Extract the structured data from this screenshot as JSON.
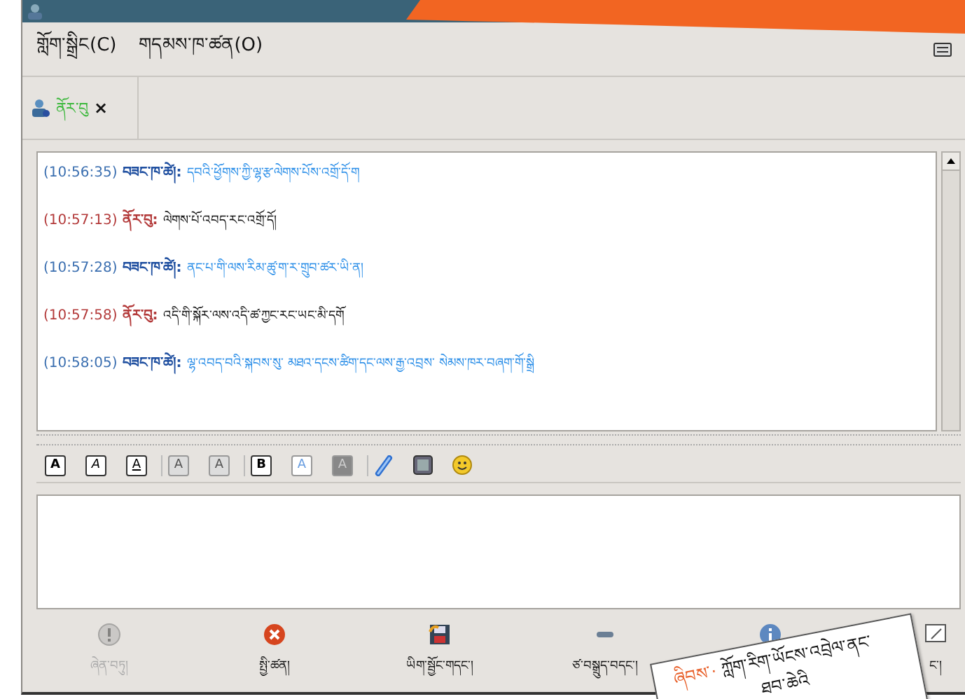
{
  "menu": [
    {
      "label": "གློག་སྒྲིང(C)"
    },
    {
      "label": "གདམས་ཁ་ཚན(O)"
    }
  ],
  "tabs": [
    {
      "label": "ནོར་བུ",
      "selected": true,
      "close": "×"
    }
  ],
  "messages": [
    {
      "time": "(10:56:35)",
      "sender": "བཟང་ཁ་ཚེ།:",
      "own": true,
      "text": "དབའི་ཕྱོགས་ཀྱི་ལྷ་རྩ་ལེགས་པོས་འགྲོ་དོ་ག"
    },
    {
      "time": "(10:57:13)",
      "sender": "ནོར་བུ:",
      "own": false,
      "text": "ལེགས་པོ་འབད་རང་འགྲོ་དོ།"
    },
    {
      "time": "(10:57:28)",
      "sender": "བཟང་ཁ་ཚེ།:",
      "own": true,
      "text": "ནང་པ་གི་ལས་རིམ་ཚུ་ག་ར་གྲུབ་ཚར་ཡི་ན།"
    },
    {
      "time": "(10:57:58)",
      "sender": "ནོར་བུ:",
      "own": false,
      "text": "འདི་གི་སྐོར་ལས་འདི་ཚ་ཀྱང་རང་ཡང་མི་དགོ"
    },
    {
      "time": "(10:58:05)",
      "sender": "བཟང་ཁ་ཚེ།:",
      "own": true,
      "text": "ལྷ་འབད་བའི་སྐབས་སུ་ མཐའ་དངས་ཚིག་དང་ལས་རྒྱ་འབྲས་ སེམས་ཁར་བཞག་གོ་སྒྲི"
    }
  ],
  "toolbar": [
    [
      {
        "kind": "bold",
        "glyph": "A"
      },
      {
        "kind": "italic",
        "glyph": "A"
      },
      {
        "kind": "underline",
        "glyph": "A"
      }
    ],
    [
      {
        "kind": "grow",
        "glyph": "A"
      },
      {
        "kind": "shrink",
        "glyph": "A"
      }
    ],
    [
      {
        "kind": "face",
        "glyph": "B"
      },
      {
        "kind": "color",
        "glyph": "A"
      },
      {
        "kind": "background",
        "glyph": "A"
      }
    ],
    [
      {
        "kind": "link"
      },
      {
        "kind": "image"
      },
      {
        "kind": "smiley"
      }
    ]
  ],
  "buttons": [
    {
      "kind": "warning",
      "label": "ཞེན་བཏུ།",
      "disabled": true
    },
    {
      "kind": "close",
      "label": "སྤྱི་ཚན།",
      "disabled": false
    },
    {
      "kind": "save",
      "label": "ཡིག་སྦྱོང་གདང་།",
      "disabled": false
    },
    {
      "kind": "minimize",
      "label": "ཙ་བསྒྲུད་བདང་།",
      "disabled": false
    },
    {
      "kind": "info",
      "disabled": false
    },
    {
      "kind": "send",
      "label": "ང་།",
      "disabled": false
    }
  ],
  "note": {
    "tag": "ཞིབས་·",
    "lines": [
      "ཀློག་རིག་ཡོངས་འབྲེལ་ནང་",
      "ཐབ་ཆེའི"
    ]
  }
}
